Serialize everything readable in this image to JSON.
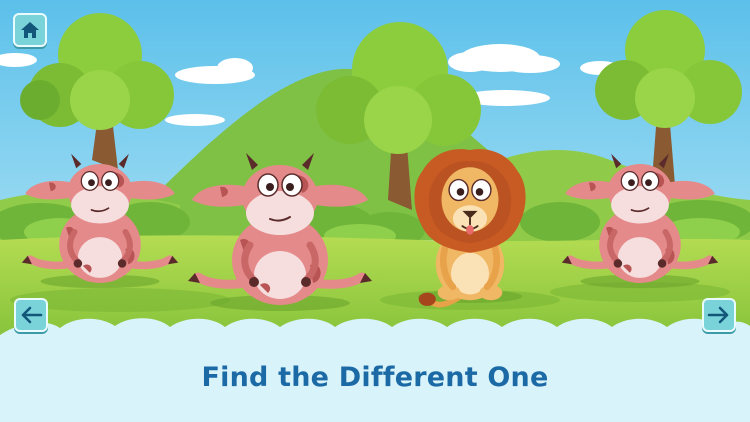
{
  "navigation": {
    "home_icon": "home-icon",
    "prev_icon": "arrow-left-icon",
    "next_icon": "arrow-right-icon"
  },
  "game": {
    "instruction": "Find the Different One",
    "choices": [
      {
        "animal": "cow"
      },
      {
        "animal": "cow"
      },
      {
        "animal": "lion"
      },
      {
        "animal": "cow"
      }
    ]
  },
  "colors": {
    "sky": "#6cc6ec",
    "caption_text": "#1b6aa5",
    "caption_panel": "#d9f3fb",
    "button": "#7ad3d9"
  }
}
